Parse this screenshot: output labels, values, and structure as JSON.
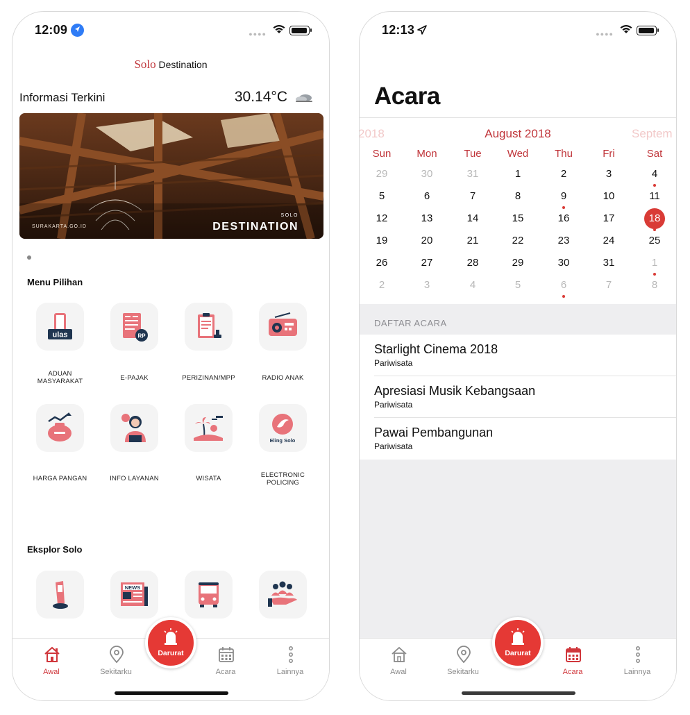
{
  "phone_left": {
    "status": {
      "time": "12:09"
    },
    "logo": {
      "solo": "Solo",
      "destination": "Destination"
    },
    "info": {
      "title": "Informasi Terkini",
      "temperature": "30.14°C"
    },
    "banner": {
      "url": "SURAKARTA.GO.ID",
      "solo": "SOLO",
      "destination": "DESTINATION"
    },
    "menu_pilihan": {
      "title": "Menu Pilihan",
      "items": [
        {
          "label": "ADUAN\nMASYARAKAT",
          "icon": "ulas-phone-icon",
          "text": "ulas"
        },
        {
          "label": "E-PAJAK",
          "icon": "tax-calculator-icon",
          "text": "RP"
        },
        {
          "label": "PERIZINAN/MPP",
          "icon": "clipboard-stamp-icon"
        },
        {
          "label": "RADIO ANAK",
          "icon": "radio-icon"
        },
        {
          "label": "HARGA PANGAN",
          "icon": "food-price-sack-icon"
        },
        {
          "label": "INFO LAYANAN",
          "icon": "customer-service-icon"
        },
        {
          "label": "WISATA",
          "icon": "beach-island-icon"
        },
        {
          "label": "ELECTRONIC\nPOLICING",
          "icon": "eling-solo-icon",
          "text": "Eling Solo"
        }
      ]
    },
    "eksplor_solo": {
      "title": "Eksplor Solo",
      "items": [
        {
          "icon": "kiosk-icon"
        },
        {
          "icon": "newspaper-icon",
          "text": "NEWS"
        },
        {
          "icon": "bus-icon"
        },
        {
          "icon": "community-hand-icon"
        }
      ]
    },
    "tabbar": {
      "awal": "Awal",
      "sekitarku": "Sekitarku",
      "darurat": "Darurat",
      "acara": "Acara",
      "lainnya": "Lainnya"
    }
  },
  "phone_right": {
    "status": {
      "time": "12:13"
    },
    "title": "Acara",
    "calendar": {
      "prev_month": "2018",
      "month": "August 2018",
      "next_month": "Septem",
      "weekdays": [
        "Sun",
        "Mon",
        "Tue",
        "Wed",
        "Thu",
        "Fri",
        "Sat"
      ],
      "weeks": [
        [
          "29",
          "30",
          "31",
          "1",
          "2",
          "3",
          "4"
        ],
        [
          "5",
          "6",
          "7",
          "8",
          "9",
          "10",
          "11"
        ],
        [
          "12",
          "13",
          "14",
          "15",
          "16",
          "17",
          "18"
        ],
        [
          "19",
          "20",
          "21",
          "22",
          "23",
          "24",
          "25"
        ],
        [
          "26",
          "27",
          "28",
          "29",
          "30",
          "31",
          "1"
        ],
        [
          "2",
          "3",
          "4",
          "5",
          "6",
          "7",
          "8"
        ]
      ],
      "selected_day": "18",
      "event_days": [
        "4",
        "9",
        "18",
        "1 (Sep)",
        "6 (Sep)"
      ]
    },
    "list": {
      "header": "DAFTAR ACARA",
      "events": [
        {
          "title": "Starlight Cinema 2018",
          "category": "Pariwisata"
        },
        {
          "title": "Apresiasi Musik Kebangsaan",
          "category": "Pariwisata"
        },
        {
          "title": "Pawai Pembangunan",
          "category": "Pariwisata"
        }
      ]
    },
    "tabbar": {
      "awal": "Awal",
      "sekitarku": "Sekitarku",
      "darurat": "Darurat",
      "acara": "Acara",
      "lainnya": "Lainnya"
    }
  },
  "colors": {
    "accent": "#d0363b",
    "darurat_button": "#e53935",
    "location_badge": "#2f7cf6",
    "list_background": "#eeeef0"
  }
}
